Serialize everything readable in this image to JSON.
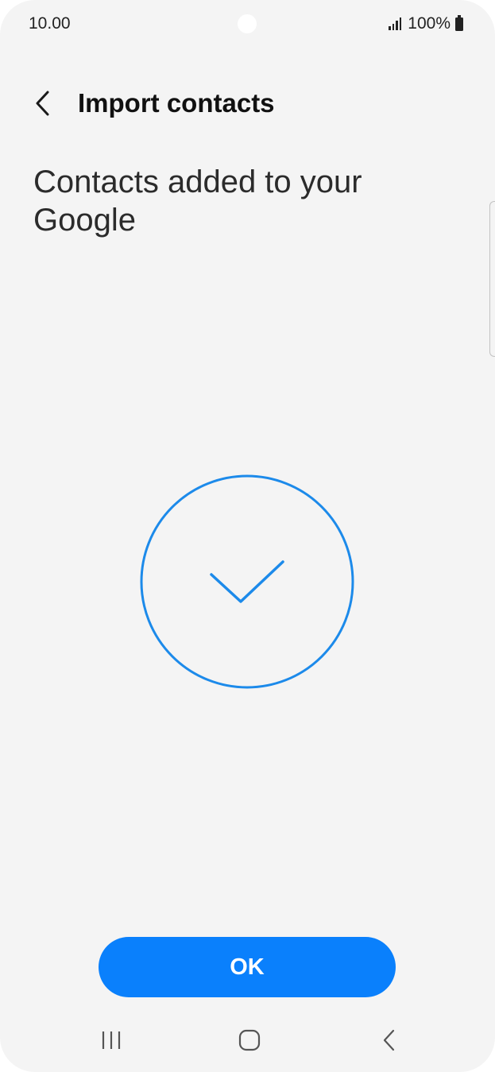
{
  "status_bar": {
    "time": "10.00",
    "battery": "100%",
    "icons": [
      "signal-icon",
      "battery-icon"
    ]
  },
  "header": {
    "title": "Import contacts",
    "back_icon": "chevron-left-icon"
  },
  "main": {
    "heading": "Contacts added to your Google",
    "graphic_icon": "checkmark-circle-icon"
  },
  "actions": {
    "ok_label": "OK"
  },
  "nav_bar": {
    "icons": [
      "recent-apps-icon",
      "home-icon",
      "back-icon"
    ]
  },
  "colors": {
    "background": "#f4f4f4",
    "accent": "#0a80fc",
    "graphic": "#1c8aea",
    "text": "#2b2b2b"
  }
}
